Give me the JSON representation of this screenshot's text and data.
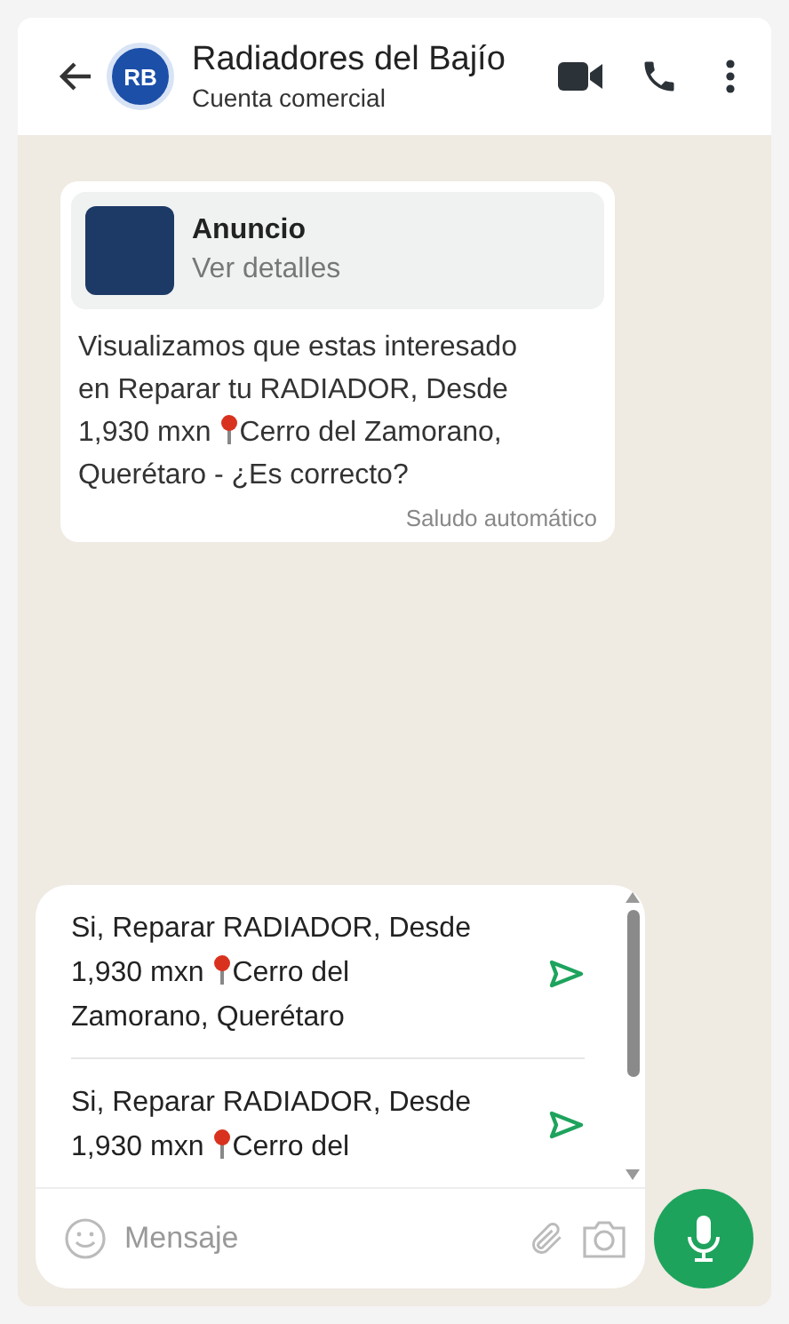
{
  "header": {
    "title": "Radiadores del Bajío",
    "subtitle": "Cuenta comercial",
    "avatar_text": "RB"
  },
  "message": {
    "ad": {
      "title": "Anuncio",
      "link": "Ver detalles"
    },
    "lines": [
      {
        "segments": [
          "Visualizamos que estas interesado"
        ]
      },
      {
        "segments": [
          "en Reparar tu RADIADOR, Desde"
        ]
      },
      {
        "segments": [
          "1,930 mxn",
          "Cerro del Zamorano,"
        ]
      },
      {
        "segments": [
          "Querétaro - ¿Es correcto?"
        ]
      }
    ],
    "footer": "Saludo automático"
  },
  "suggestions": [
    {
      "lines": [
        {
          "segments": [
            "Si, Reparar RADIADOR, Desde"
          ]
        },
        {
          "segments": [
            "1,930 mxn",
            "Cerro del"
          ]
        },
        {
          "segments": [
            "Zamorano, Querétaro"
          ]
        }
      ]
    },
    {
      "lines": [
        {
          "segments": [
            "Si, Reparar RADIADOR, Desde"
          ]
        },
        {
          "segments": [
            "1,930 mxn",
            "Cerro del"
          ]
        }
      ]
    }
  ],
  "composer": {
    "placeholder": "Mensaje"
  }
}
